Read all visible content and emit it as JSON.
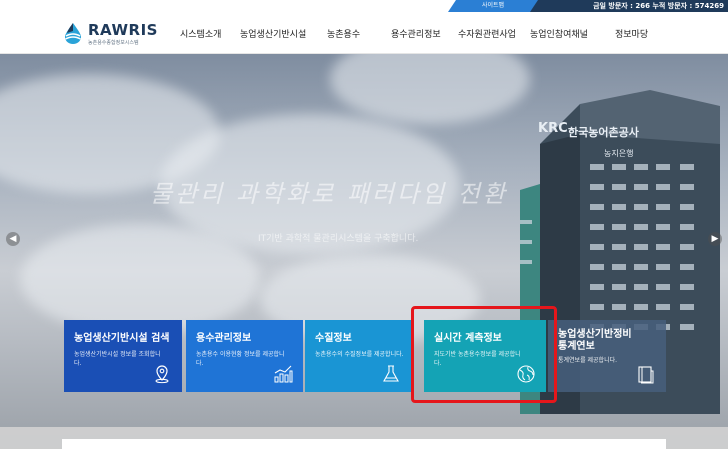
{
  "topbar": {
    "sitemap_label": "사이트맵",
    "visitors": "금일 방문자 : 266 누적 방문자 : 574269"
  },
  "logo": {
    "name": "RAWRIS",
    "subtitle": "농촌용수종합정보시스템"
  },
  "nav": {
    "items": [
      {
        "label": "시스템소개"
      },
      {
        "label": "농업생산기반시설"
      },
      {
        "label": "농촌용수"
      },
      {
        "label": "용수관리정보"
      },
      {
        "label": "수자원관련사업"
      },
      {
        "label": "농업인참여채널"
      },
      {
        "label": "정보마당"
      }
    ]
  },
  "hero": {
    "slogan": "물관리 과학화로 패러다임 전환",
    "subslogan": "IT기반 과학적 물관리시스템을 구축합니다.",
    "sign_logo": "KRC",
    "sign_text": "한국농어촌공사",
    "sign_sub": "농지은행"
  },
  "cards": [
    {
      "title": "농업생산기반시설 검색",
      "desc": "농업생산기반시설 정보를 조회합니다.",
      "color": "#1a4fb5",
      "icon": "map-pin-icon"
    },
    {
      "title": "용수관리정보",
      "desc": "농촌용수 이용현황 정보를 제공합니다.",
      "color": "#1f74d6",
      "icon": "chart-growth-icon"
    },
    {
      "title": "수질정보",
      "desc": "농촌용수의 수질정보를 제공합니다.",
      "color": "#1a95d4",
      "icon": "flask-icon"
    },
    {
      "title": "실시간 계측정보",
      "desc": "지도기반 농촌용수정보를 제공합니다.",
      "color": "#14a3b5",
      "icon": "globe-icon"
    },
    {
      "title": "농업생산기반정비 통계연보",
      "desc": "통계연보를 제공합니다.",
      "color": "#4d6a8a",
      "icon": "book-icon"
    }
  ]
}
